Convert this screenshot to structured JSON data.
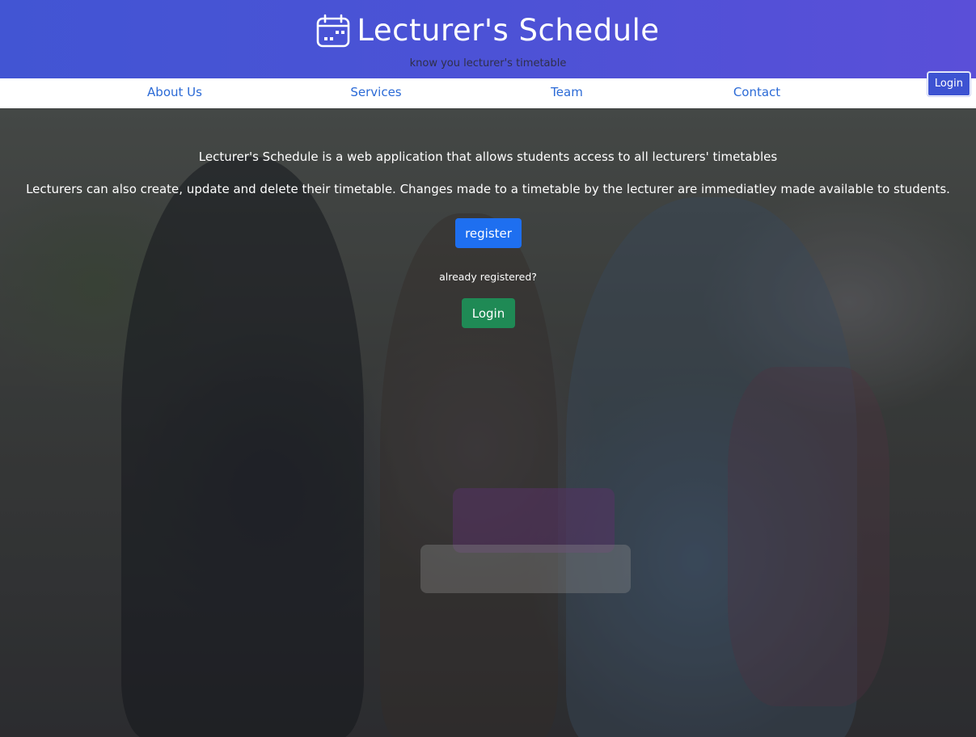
{
  "header": {
    "title": "Lecturer's Schedule",
    "tagline": "know you lecturer's timetable",
    "login_label": "Login",
    "icon": "calendar-icon",
    "gradient_start": "#4255d3",
    "gradient_end": "#5a4fd8"
  },
  "nav": {
    "items": [
      {
        "label": "About Us"
      },
      {
        "label": "Services"
      },
      {
        "label": "Team"
      },
      {
        "label": "Contact"
      }
    ],
    "link_color": "#2b6ad6"
  },
  "hero": {
    "intro_line1": "Lecturer's Schedule is a web application that allows students access to all lecturers' timetables",
    "intro_line2": "Lecturers can also create, update and delete their timetable. Changes made to a timetable by the lecturer are immediatley made available to students.",
    "register_label": "register",
    "already_registered": "already registered?",
    "login_label": "Login",
    "register_color": "#1e6ff0",
    "login_color": "#1f8a55"
  }
}
